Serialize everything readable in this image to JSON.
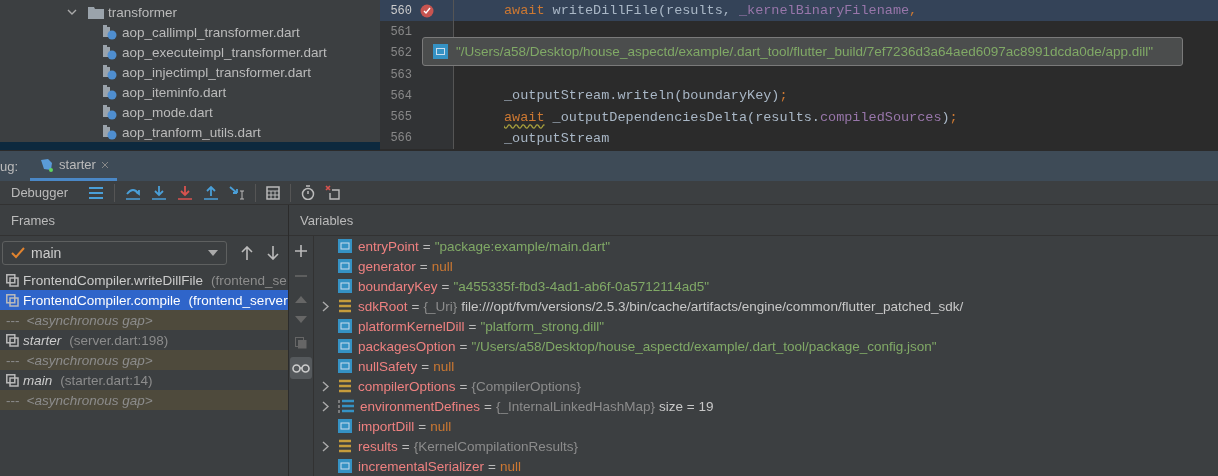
{
  "project_tree": {
    "folder": {
      "name": "transformer",
      "expanded": true
    },
    "files": [
      {
        "name": "aop_callimpl_transformer.dart"
      },
      {
        "name": "aop_executeimpl_transformer.dart"
      },
      {
        "name": "aop_injectimpl_transformer.dart"
      },
      {
        "name": "aop_iteminfo.dart"
      },
      {
        "name": "aop_mode.dart"
      },
      {
        "name": "aop_tranform_utils.dart"
      }
    ]
  },
  "editor": {
    "lines": [
      {
        "number": "560",
        "breakpoint": true,
        "current": true,
        "segments": [
          {
            "kind": "keyword",
            "text": "await "
          },
          {
            "kind": "plain",
            "text": "writeDillFile(results, "
          },
          {
            "kind": "field",
            "text": "_kernelBinaryFilename"
          },
          {
            "kind": "keyword",
            "text": ","
          }
        ]
      },
      {
        "number": "561",
        "breakpoint": false,
        "current": false
      },
      {
        "number": "562",
        "breakpoint": false,
        "current": false
      },
      {
        "number": "563",
        "breakpoint": false,
        "current": false
      },
      {
        "number": "564",
        "breakpoint": false,
        "current": false,
        "segments": [
          {
            "kind": "plain",
            "text": "_outputStream.writeln(boundaryKey)"
          },
          {
            "kind": "keyword",
            "text": ";"
          }
        ]
      },
      {
        "number": "565",
        "breakpoint": false,
        "current": false,
        "segments": [
          {
            "kind": "warn",
            "text": "await"
          },
          {
            "kind": "plain",
            "text": " _outputDependenciesDelta(results."
          },
          {
            "kind": "field",
            "text": "compiledSources"
          },
          {
            "kind": "plain",
            "text": ")"
          },
          {
            "kind": "keyword",
            "text": ";"
          }
        ]
      },
      {
        "number": "566",
        "breakpoint": false,
        "current": false,
        "segments": [
          {
            "kind": "plain",
            "text": "_outputStream"
          }
        ]
      }
    ],
    "tooltip": "\"/Users/a58/Desktop/house_aspectd/example/.dart_tool/flutter_build/7ef7236d3a64aed6097ac8991dcda0de/app.dill\""
  },
  "debug": {
    "label": "ug:",
    "tabs": [
      {
        "label": "starter",
        "selected": true
      }
    ],
    "toolbar_label": "Debugger"
  },
  "frames": {
    "title": "Frames",
    "thread": "main",
    "items": [
      {
        "kind": "frame",
        "name": "FrontendCompiler.writeDillFile",
        "location": "(frontend_se",
        "italic": false,
        "selected": false
      },
      {
        "kind": "frame",
        "name": "FrontendCompiler.compile",
        "location": "(frontend_server",
        "italic": false,
        "selected": true
      },
      {
        "kind": "gap",
        "name": "---",
        "location": "<asynchronous gap>",
        "selected": false
      },
      {
        "kind": "frame",
        "name": "starter",
        "location": "(server.dart:198)",
        "italic": true,
        "selected": false
      },
      {
        "kind": "gap",
        "name": "---",
        "location": "<asynchronous gap>",
        "selected": false
      },
      {
        "kind": "frame",
        "name": "main",
        "location": "(starter.dart:14)",
        "italic": true,
        "selected": false
      },
      {
        "kind": "gap",
        "name": "---",
        "location": "<asynchronous gap>",
        "selected": false
      }
    ]
  },
  "variables": {
    "title": "Variables",
    "items": [
      {
        "kind": "primitive",
        "expandable": false,
        "name": "entryPoint",
        "operator": "=",
        "string_value": "\"package:example/main.dart\""
      },
      {
        "kind": "primitive",
        "expandable": false,
        "name": "generator",
        "operator": "=",
        "null_value": "null"
      },
      {
        "kind": "primitive",
        "expandable": false,
        "name": "boundaryKey",
        "operator": "=",
        "string_value": "\"a455335f-fbd3-4ad1-ab6f-0a5712114ad5\""
      },
      {
        "kind": "object",
        "expandable": true,
        "name": "sdkRoot",
        "operator": "=",
        "type": "{_Uri}",
        "plain_value": "file:///opt/fvm/versions/2.5.3/bin/cache/artifacts/engine/common/flutter_patched_sdk/"
      },
      {
        "kind": "primitive",
        "expandable": false,
        "name": "platformKernelDill",
        "operator": "=",
        "string_value": "\"platform_strong.dill\""
      },
      {
        "kind": "primitive",
        "expandable": false,
        "name": "packagesOption",
        "operator": "=",
        "string_value": "\"/Users/a58/Desktop/house_aspectd/example/.dart_tool/package_config.json\""
      },
      {
        "kind": "primitive",
        "expandable": false,
        "name": "nullSafety",
        "operator": "=",
        "null_value": "null"
      },
      {
        "kind": "object",
        "expandable": true,
        "name": "compilerOptions",
        "operator": "=",
        "type": "{CompilerOptions}"
      },
      {
        "kind": "list",
        "expandable": true,
        "name": "environmentDefines",
        "operator": "=",
        "type": "{_InternalLinkedHashMap}",
        "plain_value": "size = 19"
      },
      {
        "kind": "primitive",
        "expandable": false,
        "name": "importDill",
        "operator": "=",
        "null_value": "null"
      },
      {
        "kind": "object",
        "expandable": true,
        "name": "results",
        "operator": "=",
        "type": "{KernelCompilationResults}"
      },
      {
        "kind": "primitive",
        "expandable": false,
        "name": "incrementalSerializer",
        "operator": "=",
        "null_value": "null"
      }
    ]
  }
}
